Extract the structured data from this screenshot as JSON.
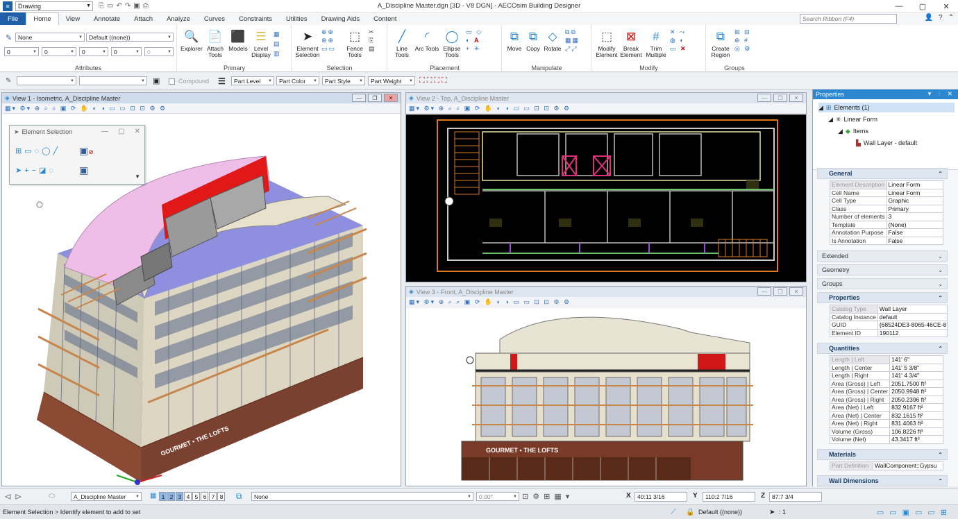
{
  "titlebar": {
    "workspace": "Drawing",
    "title": "A_Discipline Master.dgn [3D - V8 DGN] - AECOsim Building Designer"
  },
  "tabs": [
    "File",
    "Home",
    "View",
    "Annotate",
    "Attach",
    "Analyze",
    "Curves",
    "Constraints",
    "Utilities",
    "Drawing Aids",
    "Content"
  ],
  "ribbon": {
    "search_placeholder": "Search Ribbon (F4)",
    "attributes": {
      "level": "None",
      "template": "Default ((none))",
      "color": "0",
      "style": "0",
      "weight": "0",
      "transparency": "0",
      "priority": "0",
      "label": "Attributes"
    },
    "primary": {
      "label": "Primary",
      "buttons": [
        "Explorer",
        "Attach Tools",
        "Models",
        "Level Display"
      ]
    },
    "selection": {
      "label": "Selection",
      "buttons": [
        "Element Selection",
        "Fence Tools"
      ]
    },
    "placement": {
      "label": "Placement",
      "buttons": [
        "Line Tools",
        "Arc Tools",
        "Ellipse Tools"
      ]
    },
    "manipulate": {
      "label": "Manipulate",
      "buttons": [
        "Move",
        "Copy",
        "Rotate"
      ]
    },
    "modify": {
      "label": "Modify",
      "buttons": [
        "Modify Element",
        "Break Element",
        "Trim Multiple"
      ]
    },
    "groups": {
      "label": "Groups",
      "buttons": [
        "Create Region"
      ]
    }
  },
  "attrbar": {
    "compound": "Compound",
    "part_level": "Part Level",
    "part_color": "Part Color",
    "part_style": "Part Style",
    "part_weight": "Part Weight"
  },
  "views": {
    "v1": "View 1 - Isometric, A_Discipline Master",
    "v2": "View 2 - Top, A_Discipline Master",
    "v3": "View 3 - Front, A_Discipline Master"
  },
  "element_selection": {
    "title": "Element Selection"
  },
  "building_sign": "GOURMET • THE LOFTS",
  "properties": {
    "title": "Properties",
    "tree": [
      "Elements (1)",
      "Linear Form",
      "Items",
      "Wall Layer - default"
    ],
    "general": {
      "label": "General",
      "rows": [
        [
          "Element Description",
          "Linear Form"
        ],
        [
          "Cell Name",
          "Linear Form"
        ],
        [
          "Cell Type",
          "Graphic"
        ],
        [
          "Class",
          "Primary"
        ],
        [
          "Number of elements",
          "3"
        ],
        [
          "Template",
          "(None)"
        ],
        [
          "Annotation Purpose",
          "False"
        ],
        [
          "Is Annotation",
          "False"
        ]
      ]
    },
    "collapsed": [
      "Extended",
      "Geometry",
      "Groups"
    ],
    "props_section": {
      "label": "Properties",
      "rows": [
        [
          "Catalog Type",
          "Wall Layer"
        ],
        [
          "Catalog Instance",
          "default"
        ],
        [
          "GUID",
          "{68524DE3-8065-46CE-8"
        ],
        [
          "Element ID",
          "190112"
        ]
      ]
    },
    "quantities": {
      "label": "Quantities",
      "rows": [
        [
          "Length | Left",
          "141' 6\""
        ],
        [
          "Length | Center",
          "141' 5 3/8\""
        ],
        [
          "Length | Right",
          "141' 4 3/4\""
        ],
        [
          "Area (Gross) | Left",
          "2051.7500 ft²"
        ],
        [
          "Area (Gross) | Center",
          "2050.9948 ft²"
        ],
        [
          "Area (Gross) | Right",
          "2050.2396 ft²"
        ],
        [
          "Area (Net) | Left",
          "832.9167 ft²"
        ],
        [
          "Area (Net) | Center",
          "832.1615 ft²"
        ],
        [
          "Area (Net) | Right",
          "831.4063 ft²"
        ],
        [
          "Volume (Gross)",
          "106.8226 ft³"
        ],
        [
          "Volume (Net)",
          "43.3417 ft³"
        ]
      ]
    },
    "materials": {
      "label": "Materials",
      "rows": [
        [
          "Part Definition",
          "WallComponent::Gypsu"
        ]
      ]
    },
    "wall_dimensions": "Wall Dimensions"
  },
  "bottombar": {
    "model": "A_Discipline Master",
    "views": [
      "1",
      "2",
      "3",
      "4",
      "5",
      "6",
      "7",
      "8"
    ],
    "level": "None",
    "angle": "0.00°",
    "x_label": "X",
    "x": "40:11 3/16",
    "y_label": "Y",
    "y": "110:2 7/16",
    "z_label": "Z",
    "z": "87:7 3/4"
  },
  "status": {
    "prompt": "Element Selection > Identify element to add to set",
    "template": "Default ((none))",
    "count": ": 1"
  },
  "colors": {
    "accent": "#1e5fa8",
    "panel_title": "#2a87d0"
  }
}
